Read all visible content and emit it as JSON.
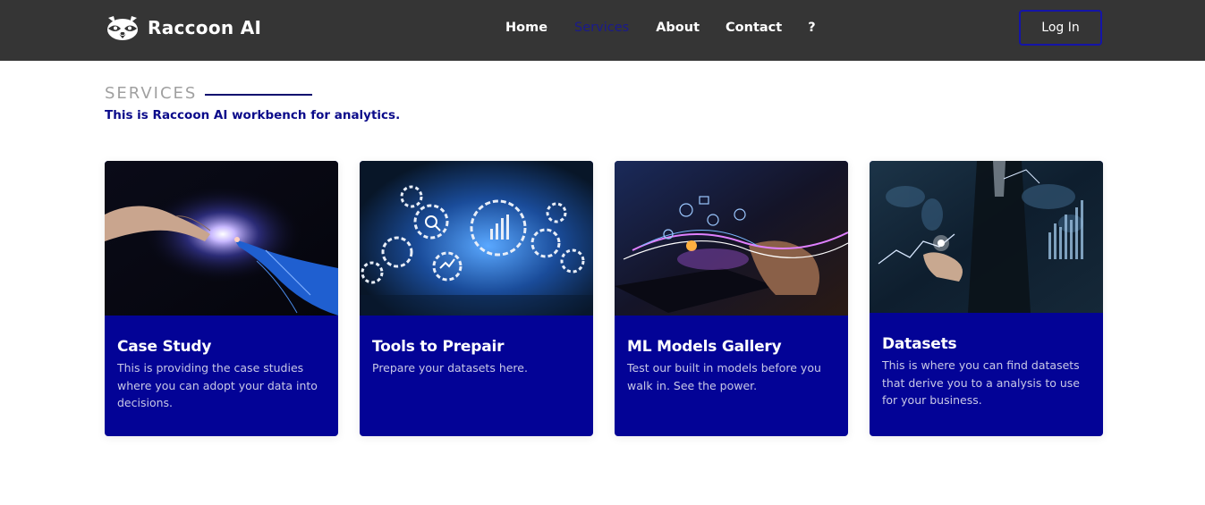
{
  "nav": {
    "brand": "Raccoon AI",
    "links": [
      "Home",
      "Services",
      "About",
      "Contact",
      "?"
    ],
    "active": "Services",
    "login": "Log In"
  },
  "section": {
    "title": "SERVICES",
    "subtitle": "This is Raccoon AI workbench for analytics."
  },
  "cards": [
    {
      "title": "Case Study",
      "description": "This is providing the case studies where you can adopt your data into decisions.",
      "image_icon": "hand-reaching-robot-hand-icon"
    },
    {
      "title": "Tools to Prepair",
      "description": "Prepare your datasets here.",
      "image_icon": "gears-analytics-icon"
    },
    {
      "title": "ML Models Gallery",
      "description": "Test our built in models before you walk in. See the power.",
      "image_icon": "hands-laptop-holograms-icon"
    },
    {
      "title": "Datasets",
      "description": "This is where you can find datasets that derive you to a analysis to use for your business.",
      "image_icon": "businessman-world-map-charts-icon"
    }
  ],
  "colors": {
    "navbar": "#353535",
    "card_bg": "#030396",
    "accent": "#1414a8",
    "active_link": "#1a1a8c"
  }
}
